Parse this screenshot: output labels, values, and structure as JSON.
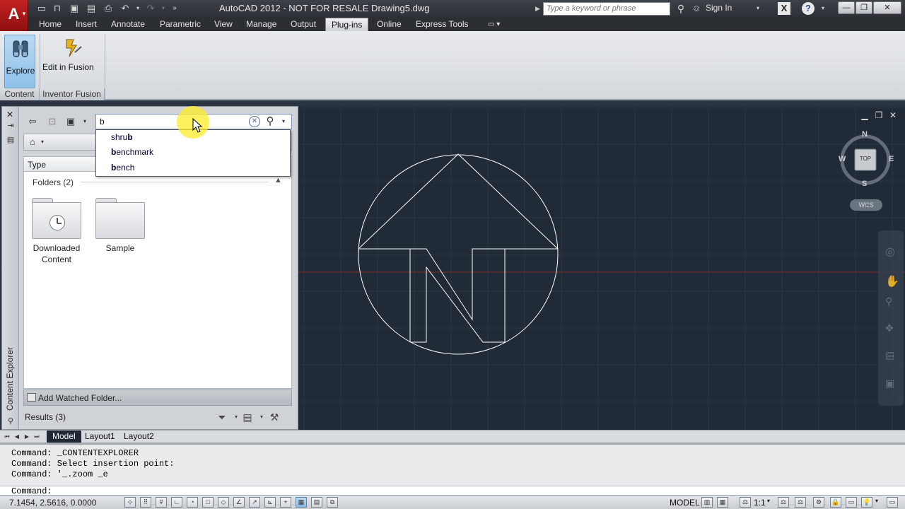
{
  "title_bar": {
    "app_title": "AutoCAD 2012 - NOT FOR RESALE    Drawing5.dwg",
    "search_placeholder": "Type a keyword or phrase",
    "sign_in": "Sign In",
    "app_menu_letter": "A",
    "quick_access_icons": [
      "new-icon",
      "open-icon",
      "save-icon",
      "save-as-icon",
      "print-icon",
      "undo-icon",
      "redo-icon"
    ]
  },
  "ribbon": {
    "tabs": [
      "Home",
      "Insert",
      "Annotate",
      "Parametric",
      "View",
      "Manage",
      "Output",
      "Plug-ins",
      "Online",
      "Express Tools"
    ],
    "active_tab": "Plug-ins",
    "buttons": {
      "explore": "Explore",
      "edit_in_fusion": "Edit in Fusion"
    },
    "panels": {
      "content": "Content",
      "inventor_fusion": "Inventor Fusion"
    }
  },
  "content_explorer": {
    "palette_title": "Content Explorer",
    "search_value": "b",
    "column_header": "Type",
    "folders_header": "Folders (2)",
    "folders": [
      {
        "line1": "Downloaded",
        "line2": "Content",
        "icon": "clock-folder-icon"
      },
      {
        "line1": "Sample",
        "line2": "",
        "icon": "folder-icon"
      }
    ],
    "add_watched_folder": "Add Watched Folder...",
    "results": "Results (3)"
  },
  "autocomplete": {
    "items": [
      {
        "prefix": "shru",
        "bold": "b",
        "suffix": ""
      },
      {
        "prefix": "",
        "bold": "b",
        "suffix": "enchmark"
      },
      {
        "prefix": "",
        "bold": "b",
        "suffix": "ench"
      }
    ]
  },
  "viewcube": {
    "north": "N",
    "south": "S",
    "east": "E",
    "west": "W",
    "face": "TOP",
    "ucs": "WCS"
  },
  "layout_tabs": [
    "Model",
    "Layout1",
    "Layout2"
  ],
  "active_layout": "Model",
  "command_history": [
    "Command: _CONTENTEXPLORER",
    "Command: Select insertion point:",
    "Command: '_.zoom _e"
  ],
  "command_prompt": "Command:",
  "status_bar": {
    "coordinates": "7.1454, 2.5616, 0.0000",
    "model": "MODEL",
    "annotation_scale": "1:1"
  },
  "colors": {
    "drawing_background": "#212a37",
    "grid_line": "#2c3647",
    "x_axis": "#8a2a2a",
    "geometry": "#ffffff",
    "ribbon_active": "#e2e6ea"
  }
}
